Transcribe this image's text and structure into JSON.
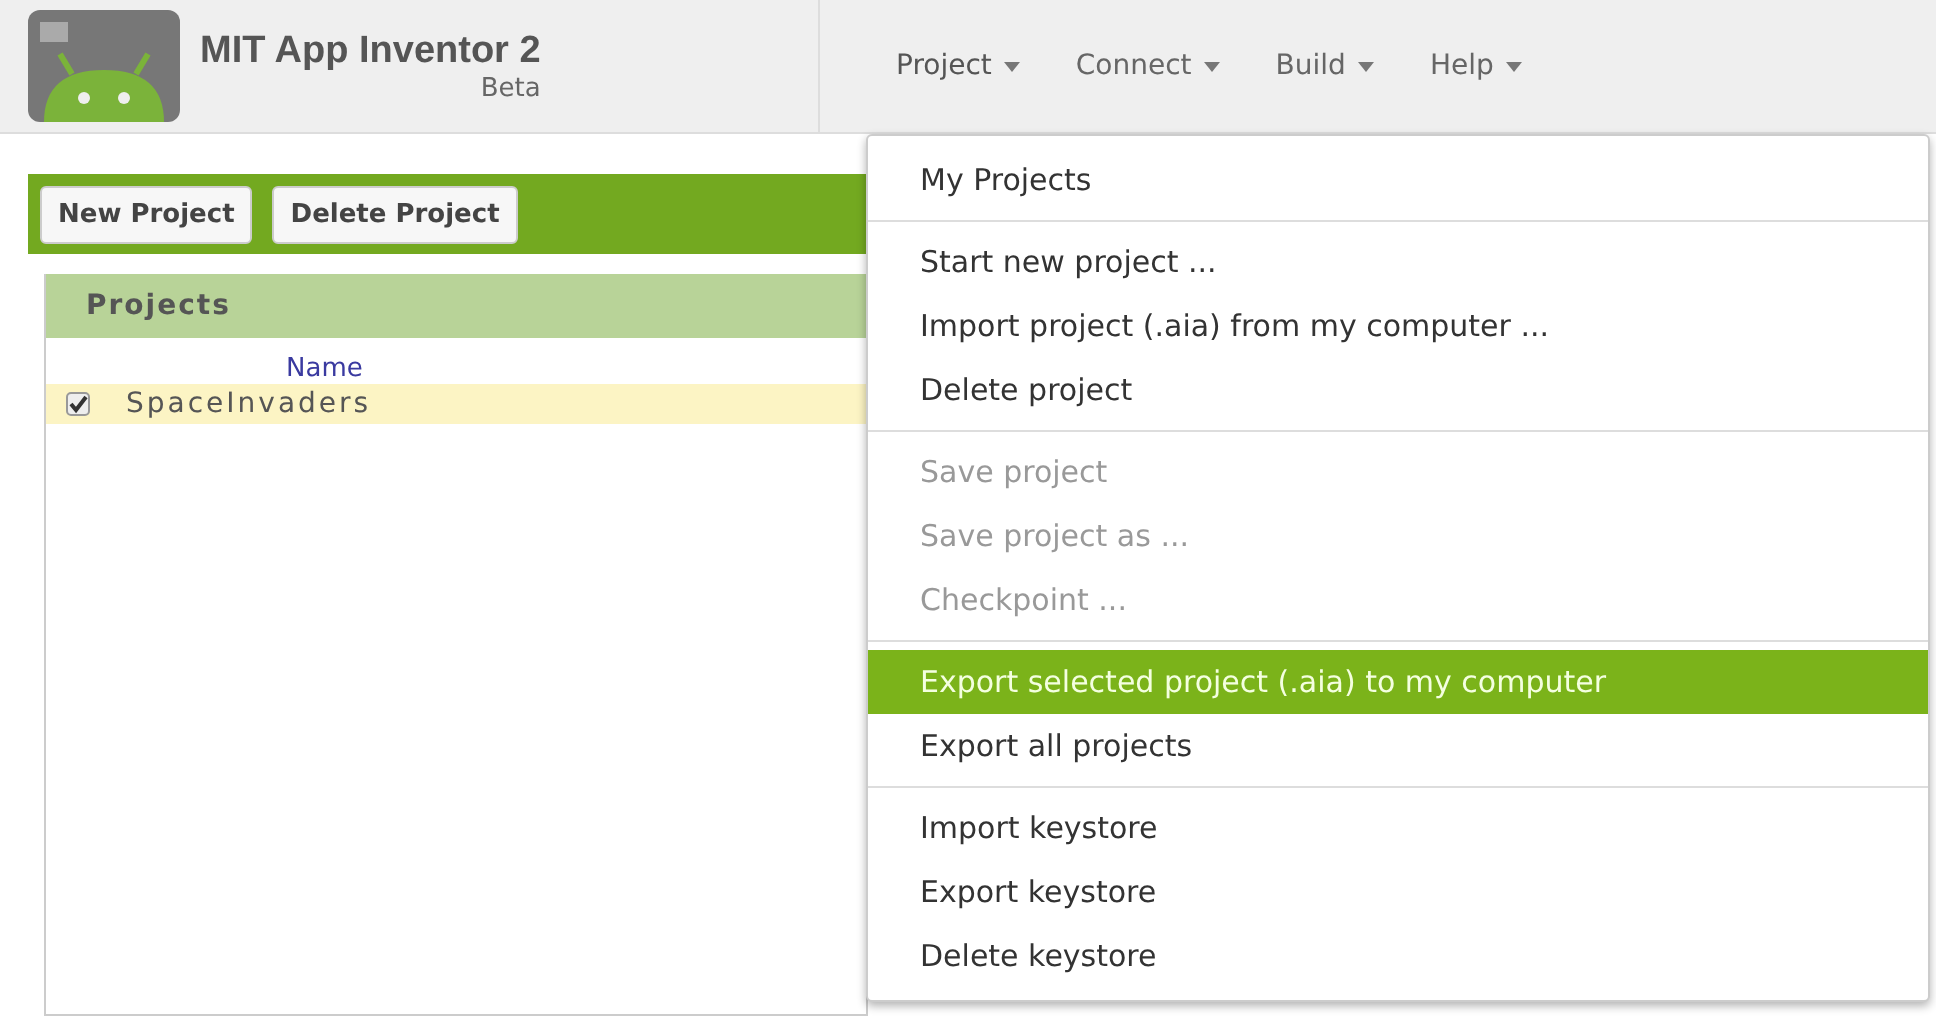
{
  "app": {
    "title": "MIT App Inventor 2",
    "subtitle": "Beta"
  },
  "menubar": [
    {
      "label": "Project",
      "selected": true
    },
    {
      "label": "Connect",
      "selected": false
    },
    {
      "label": "Build",
      "selected": false
    },
    {
      "label": "Help",
      "selected": false
    }
  ],
  "toolbar": [
    "New Project",
    "Delete Project"
  ],
  "projects_panel": {
    "title": "Projects",
    "columns": [
      "Name"
    ],
    "rows": [
      {
        "name": "SpaceInvaders",
        "checked": true,
        "selected": true
      }
    ]
  },
  "menu": {
    "groups": [
      [
        {
          "label": "My Projects",
          "disabled": false,
          "selected": false
        }
      ],
      [
        {
          "label": "Start new project ...",
          "disabled": false,
          "selected": false
        },
        {
          "label": "Import project (.aia) from my computer ...",
          "disabled": false,
          "selected": false
        },
        {
          "label": "Delete project",
          "disabled": false,
          "selected": false
        }
      ],
      [
        {
          "label": "Save project",
          "disabled": true,
          "selected": false
        },
        {
          "label": "Save project as ...",
          "disabled": true,
          "selected": false
        },
        {
          "label": "Checkpoint ...",
          "disabled": true,
          "selected": false
        }
      ],
      [
        {
          "label": "Export selected project (.aia) to my computer",
          "disabled": false,
          "selected": true
        },
        {
          "label": "Export all projects",
          "disabled": false,
          "selected": false
        }
      ],
      [
        {
          "label": "Import keystore",
          "disabled": false,
          "selected": false
        },
        {
          "label": "Export keystore",
          "disabled": false,
          "selected": false
        },
        {
          "label": "Delete keystore",
          "disabled": false,
          "selected": false
        }
      ]
    ]
  }
}
